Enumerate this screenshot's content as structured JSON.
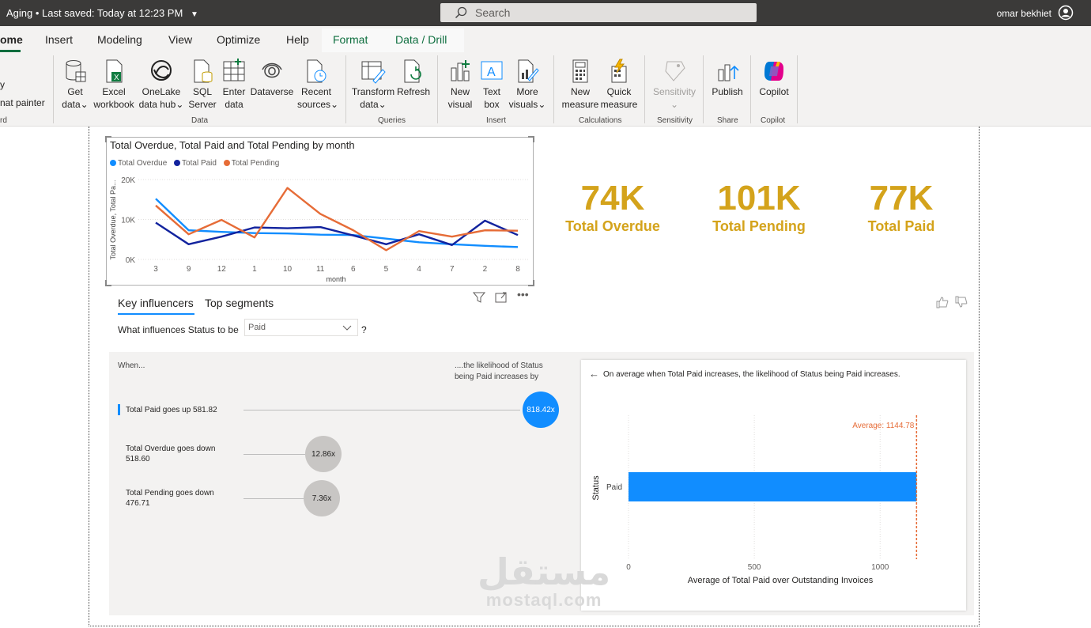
{
  "titlebar": {
    "doc_title": "Aging",
    "saved": "Last saved: Today at 12:23 PM",
    "search_placeholder": "Search",
    "user_name": "omar bekhiet"
  },
  "tabs": [
    "ome",
    "Insert",
    "Modeling",
    "View",
    "Optimize",
    "Help",
    "Format",
    "Data / Drill"
  ],
  "ribbon": {
    "clipboard_fragment": "y",
    "format_painter": "nat painter",
    "clipboard_group": "rd",
    "data_group": "Data",
    "queries_group": "Queries",
    "insert_group": "Insert",
    "calc_group": "Calculations",
    "sens_group": "Sensitivity",
    "share_group": "Share",
    "copilot_group": "Copilot",
    "buttons": {
      "get_data": [
        "Get",
        "data"
      ],
      "excel": [
        "Excel",
        "workbook"
      ],
      "onelake": [
        "OneLake",
        "data hub"
      ],
      "sql": [
        "SQL",
        "Server"
      ],
      "enter": [
        "Enter",
        "data"
      ],
      "dataverse": [
        "Dataverse",
        ""
      ],
      "recent": [
        "Recent",
        "sources"
      ],
      "transform": [
        "Transform",
        "data"
      ],
      "refresh": [
        "Refresh",
        ""
      ],
      "new_visual": [
        "New",
        "visual"
      ],
      "text_box": [
        "Text",
        "box"
      ],
      "more_visuals": [
        "More",
        "visuals"
      ],
      "new_measure": [
        "New",
        "measure"
      ],
      "quick_measure": [
        "Quick",
        "measure"
      ],
      "sensitivity": [
        "Sensitivity",
        ""
      ],
      "publish": [
        "Publish",
        ""
      ],
      "copilot": [
        "Copilot",
        ""
      ]
    }
  },
  "line_chart": {
    "title": "Total Overdue, Total Paid and Total Pending by month",
    "xlabel": "month",
    "ylabel": "Total Overdue, Total Pa...",
    "y_ticks": [
      "20K",
      "10K",
      "0K"
    ]
  },
  "chart_data": [
    {
      "type": "line",
      "title": "Total Overdue, Total Paid and Total Pending by month",
      "xlabel": "month",
      "ylabel": "Total Overdue, Total Pa...",
      "categories": [
        "3",
        "9",
        "12",
        "1",
        "10",
        "11",
        "6",
        "5",
        "4",
        "7",
        "2",
        "8"
      ],
      "ylim": [
        0,
        20000
      ],
      "grid": true,
      "legend": "top-left",
      "series": [
        {
          "name": "Total Overdue",
          "color": "#118dff",
          "values": [
            15200,
            7300,
            6900,
            6600,
            6500,
            6200,
            6100,
            5200,
            4300,
            3800,
            3400,
            3100
          ]
        },
        {
          "name": "Total Paid",
          "color": "#12239e",
          "values": [
            9200,
            3800,
            5700,
            8000,
            7800,
            8100,
            6000,
            3800,
            6300,
            3600,
            9700,
            6100
          ]
        },
        {
          "name": "Total Pending",
          "color": "#e66c37",
          "values": [
            13500,
            6300,
            9900,
            5500,
            17900,
            11400,
            7300,
            2300,
            7100,
            5700,
            7300,
            7200
          ]
        }
      ]
    },
    {
      "type": "bar",
      "title": "",
      "xlabel": "Average of Total Paid over Outstanding Invoices",
      "ylabel": "Status",
      "categories": [
        "Paid"
      ],
      "values": [
        1144.78
      ],
      "xlim": [
        0,
        1150
      ],
      "x_ticks": [
        0,
        500,
        1000
      ],
      "reference_line": {
        "label": "Average: 1144.78",
        "value": 1144.78,
        "color": "#e66c37"
      }
    }
  ],
  "kpis": [
    {
      "value": "74K",
      "label": "Total Overdue"
    },
    {
      "value": "101K",
      "label": "Total Pending"
    },
    {
      "value": "77K",
      "label": "Total Paid"
    }
  ],
  "kpi_color": "#d4a31b",
  "key_influencers": {
    "tab_key": "Key influencers",
    "tab_top": "Top segments",
    "question": "What influences Status to be",
    "selected": "Paid",
    "qmark": "?",
    "when": "When...",
    "likelihood": "....the likelihood of Status being Paid increases by",
    "influencers": [
      {
        "text": "Total Paid goes up 581.82",
        "multiplier": "818.42x"
      },
      {
        "text": "Total Overdue goes down 518.60",
        "multiplier": "12.86x"
      },
      {
        "text": "Total Pending goes down 476.71",
        "multiplier": "7.36x"
      }
    ],
    "detail_header": "On average when Total Paid increases, the likelihood of Status being Paid increases.",
    "detail_average": "Average: 1144.78",
    "detail_category": "Paid",
    "detail_ylabel": "Status",
    "detail_xlabel": "Average of Total Paid over Outstanding Invoices"
  },
  "watermark": {
    "arabic": "مستقل",
    "latin": "mostaql.com"
  }
}
